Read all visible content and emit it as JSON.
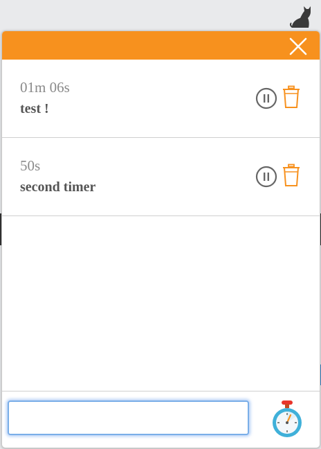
{
  "topbar": {
    "icon": "cat-icon"
  },
  "popup": {
    "header": {
      "close_icon": "close-icon",
      "accent_color": "#f7911e"
    },
    "timers": [
      {
        "time": "01m 06s",
        "name": "test !"
      },
      {
        "time": "50s",
        "name": "second timer"
      }
    ],
    "input": {
      "value": "",
      "placeholder": ""
    },
    "start_icon": "stopwatch-icon"
  }
}
